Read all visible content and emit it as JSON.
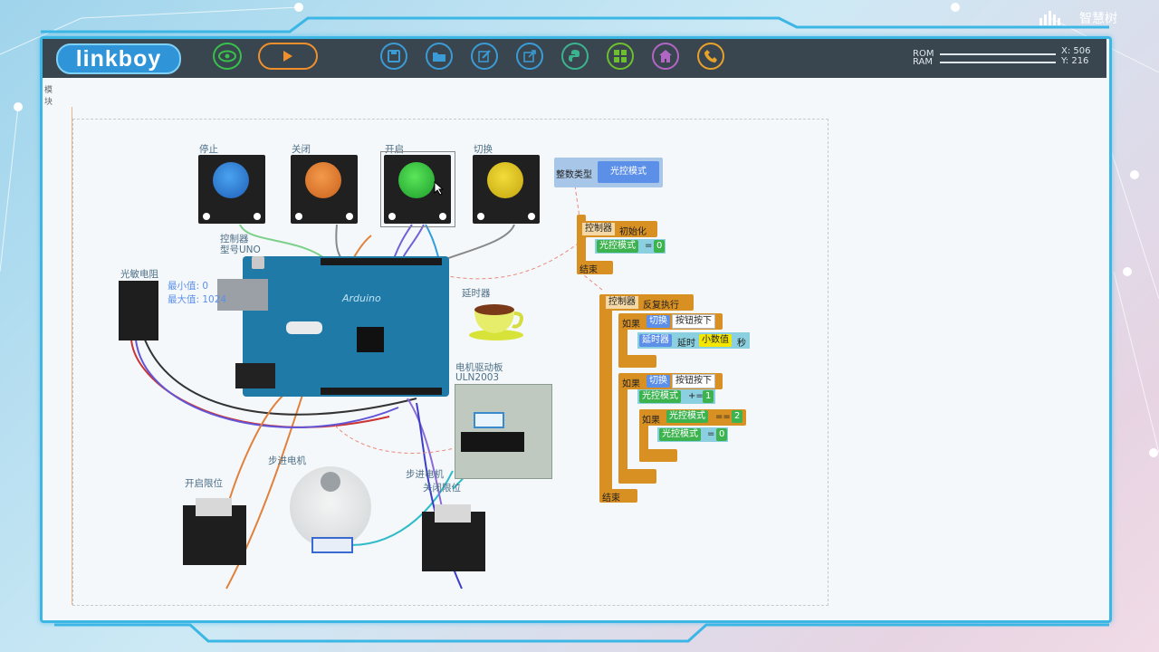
{
  "app": {
    "logo": "linkboy",
    "watermark": "智慧树"
  },
  "meters": {
    "rom_label": "ROM",
    "ram_label": "RAM",
    "x_readout": "X: 506",
    "y_readout": "Y: 216"
  },
  "toolbar": {
    "icons": [
      "view-eye-icon",
      "run-play-icon",
      "save-icon",
      "open-folder-icon",
      "edit-icon",
      "export-icon",
      "python-icon",
      "module-grid-icon",
      "home-icon",
      "phone-icon"
    ]
  },
  "sidebar": {
    "partial_label": "模块"
  },
  "components": {
    "btn_stop": "停止",
    "btn_close": "关闭",
    "btn_open": "开启",
    "btn_switch": "切换",
    "controller_name": "控制器",
    "controller_model": "型号UNO",
    "arduino_text": "Arduino",
    "ldr_label": "光敏电阻",
    "ldr_min": "最小值: 0",
    "ldr_max": "最大值: 1024",
    "delay_label": "延时器",
    "driver_label1": "电机驱动板",
    "driver_label2": "ULN2003",
    "motor_label": "步进电机",
    "limit_open": "开启限位",
    "limit_close": "关闭限位",
    "stepper_run_label": "步进电机"
  },
  "blocks": {
    "var_decl_type": "整数类型",
    "var_decl_name": "光控模式",
    "init_ctrl": "控制器",
    "init_label": "初始化",
    "init_var": "光控模式",
    "init_eq": "=",
    "init_val": "0",
    "end1": "结束",
    "loop_ctrl": "控制器",
    "loop_label": "反复执行",
    "if1": "如果",
    "if1_target": "切换",
    "if1_cond": "按钮按下",
    "delay_target": "延时器",
    "delay_action": "延时",
    "delay_value": "小数值",
    "delay_unit": "秒",
    "if2": "如果",
    "if2_target": "切换",
    "if2_cond": "按钮按下",
    "inc_var": "光控模式",
    "inc_op": "+=",
    "inc_val": "1",
    "if3": "如果",
    "if3_var": "光控模式",
    "if3_op": "==",
    "if3_val": "2",
    "reset_var": "光控模式",
    "reset_op": "=",
    "reset_val": "0",
    "end2": "结束"
  },
  "colors": {
    "frame": "#3cb7e5",
    "topbar": "#39464f",
    "board": "#1f7aa8",
    "block_orange": "#d99023",
    "block_green": "#3db34f",
    "block_blue": "#5b8fe8"
  }
}
